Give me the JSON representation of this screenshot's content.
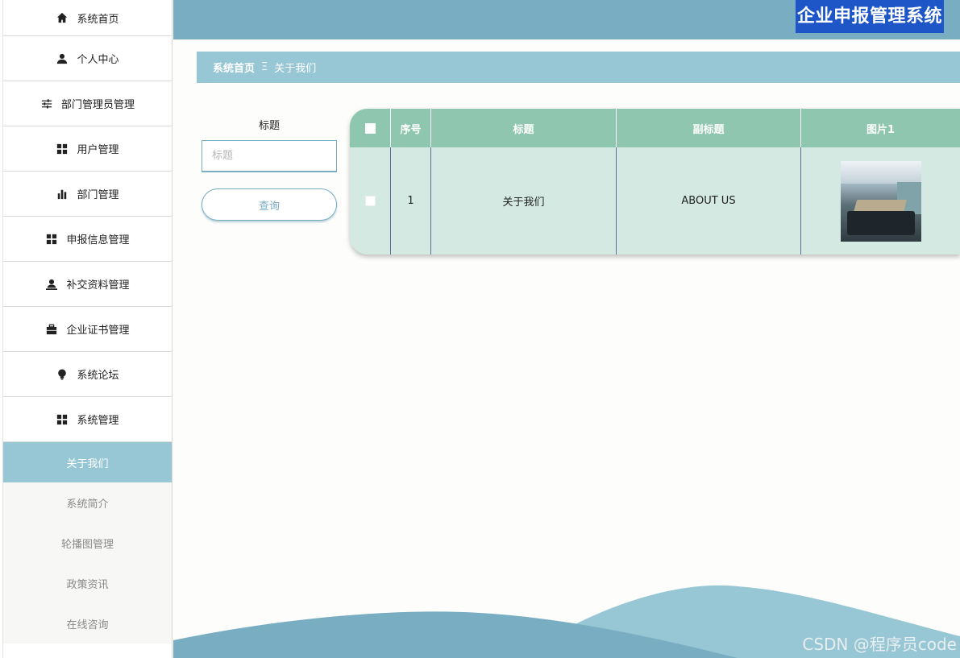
{
  "app": {
    "title": "企业申报管理系统"
  },
  "sidebar": {
    "items": [
      {
        "label": "系统首页",
        "icon": "home-icon"
      },
      {
        "label": "个人中心",
        "icon": "user-icon"
      },
      {
        "label": "部门管理员管理",
        "icon": "sliders-icon"
      },
      {
        "label": "用户管理",
        "icon": "grid-icon"
      },
      {
        "label": "部门管理",
        "icon": "bar-chart-icon"
      },
      {
        "label": "申报信息管理",
        "icon": "grid-icon"
      },
      {
        "label": "补交资料管理",
        "icon": "user-tie-icon"
      },
      {
        "label": "企业证书管理",
        "icon": "briefcase-icon"
      },
      {
        "label": "系统论坛",
        "icon": "lightbulb-icon"
      },
      {
        "label": "系统管理",
        "icon": "grid-icon"
      }
    ],
    "submenu": [
      {
        "label": "关于我们",
        "active": true
      },
      {
        "label": "系统简介"
      },
      {
        "label": "轮播图管理"
      },
      {
        "label": "政策资讯"
      },
      {
        "label": "在线咨询"
      }
    ]
  },
  "breadcrumb": {
    "home": "系统首页",
    "separator": "Ξ",
    "current": "关于我们"
  },
  "search": {
    "label": "标题",
    "placeholder": "标题",
    "value": "",
    "button": "查询"
  },
  "table": {
    "columns": [
      "序号",
      "标题",
      "副标题",
      "图片1"
    ],
    "rows": [
      {
        "index": "1",
        "title": "关于我们",
        "subtitle": "ABOUT US",
        "image": "meeting-room-photo"
      }
    ]
  },
  "watermark": "CSDN @程序员code",
  "colors": {
    "topbar": "#79adc1",
    "breadcrumb": "#97c7d5",
    "table_header": "#8fc6af",
    "table_row": "#d3e9e1",
    "title_highlight": "#1e56c8"
  }
}
